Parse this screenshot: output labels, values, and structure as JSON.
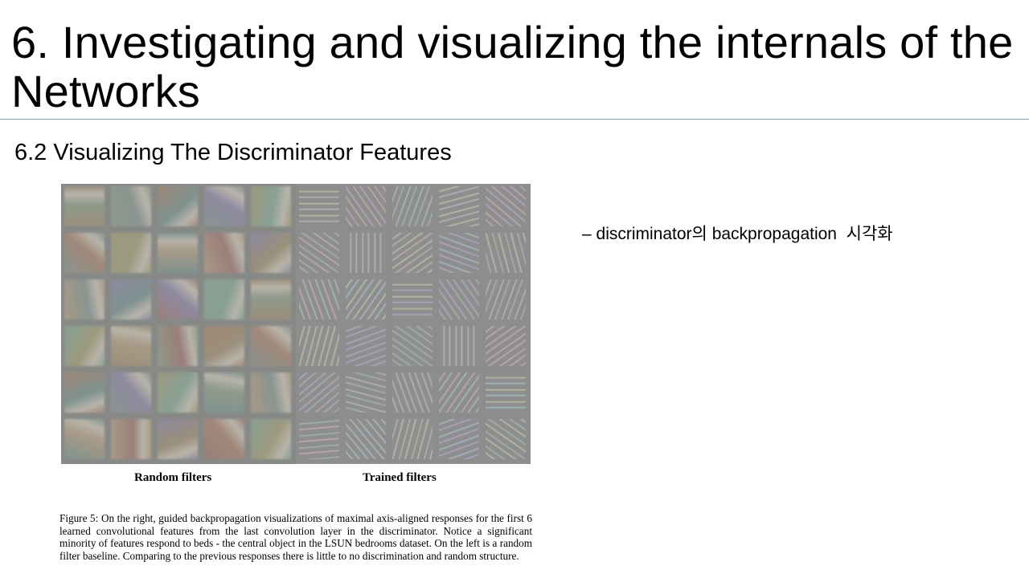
{
  "slide": {
    "title": "6. Investigating and visualizing the internals of the Networks",
    "subtitle": "6.2 Visualizing The Discriminator Features",
    "bullet": "– discriminator의 backpropagation  시각화"
  },
  "figure": {
    "left_label": "Random filters",
    "right_label": "Trained filters",
    "caption": "Figure 5: On the right, guided backpropagation visualizations of maximal axis-aligned responses for the first 6 learned convolutional features from the last convolution layer in the discriminator. Notice a significant minority of features respond to beds - the central object in the LSUN bedrooms dataset. On the left is a random filter baseline. Comparing to the previous responses there is little to no discrimination and random structure.",
    "grid_rows": 6,
    "grid_cols_per_side": 5,
    "photo_palette": [
      "#9a8f7a",
      "#8f9a8a",
      "#a08878",
      "#8a9490",
      "#9c9a7e",
      "#7f9290",
      "#a89a86",
      "#8e8aa0",
      "#9a7e7a",
      "#88a094"
    ],
    "edge_palette": [
      "#b9b9c4",
      "#c8b0b0",
      "#a8c0c8",
      "#c0c4a8",
      "#b8a8c8",
      "#a4b8b0"
    ]
  }
}
